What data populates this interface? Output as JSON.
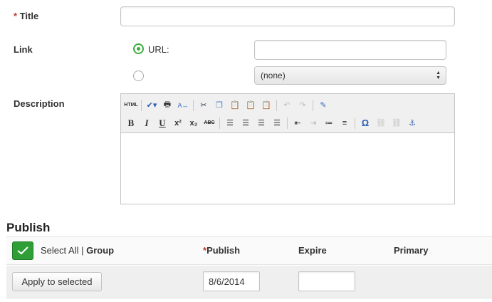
{
  "form": {
    "title_required_mark": "*",
    "title_label": "Title",
    "title_value": "",
    "link_label": "Link",
    "url_option_label": "URL:",
    "url_value": "",
    "select_value": "(none)",
    "description_label": "Description"
  },
  "editor": {
    "toolbar_row1": [
      "html",
      "spellcheck",
      "print",
      "find-replace",
      "cut",
      "copy",
      "paste",
      "paste-word",
      "paste-text",
      "undo",
      "redo",
      "edit-source"
    ],
    "toolbar_row2": [
      "bold",
      "italic",
      "underline",
      "superscript",
      "subscript",
      "strikethrough",
      "align-left",
      "align-center",
      "align-right",
      "justify",
      "outdent",
      "indent",
      "ordered-list",
      "unordered-list",
      "special-char",
      "link",
      "unlink",
      "anchor"
    ],
    "html_label": "HTML",
    "bold_label": "B",
    "italic_label": "I",
    "underline_label": "U",
    "sup_label": "x²",
    "sub_label": "x₂",
    "strike_label": "ABC",
    "omega_label": "Ω"
  },
  "publish": {
    "heading": "Publish",
    "select_all_label": "Select All",
    "separator": "|",
    "group_label": "Group",
    "publish_required_mark": "*",
    "publish_col": "Publish",
    "expire_col": "Expire",
    "primary_col": "Primary",
    "apply_button": "Apply to selected",
    "publish_date": "8/6/2014",
    "expire_date": ""
  },
  "colors": {
    "required": "#c0392b",
    "radio_checked": "#3cae3c",
    "check_button": "#2f9e36"
  }
}
